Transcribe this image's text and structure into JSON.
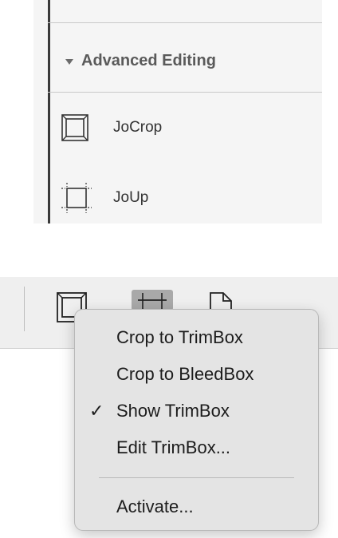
{
  "panel": {
    "section_title": "Advanced Editing",
    "tools": [
      {
        "label": "JoCrop",
        "icon": "crop-box-icon"
      },
      {
        "label": "JoUp",
        "icon": "trim-box-icon"
      }
    ]
  },
  "toolbar": {
    "buttons": [
      {
        "icon": "crop-box-icon",
        "selected": false
      },
      {
        "icon": "trim-box-icon",
        "selected": true
      },
      {
        "icon": "page-icon",
        "selected": false
      }
    ]
  },
  "context_menu": {
    "items": [
      {
        "label": "Crop to TrimBox",
        "checked": false
      },
      {
        "label": "Crop to BleedBox",
        "checked": false
      },
      {
        "label": "Show TrimBox",
        "checked": true
      },
      {
        "label": "Edit TrimBox...",
        "checked": false
      }
    ],
    "footer_item": {
      "label": "Activate..."
    },
    "check_glyph": "✓"
  }
}
